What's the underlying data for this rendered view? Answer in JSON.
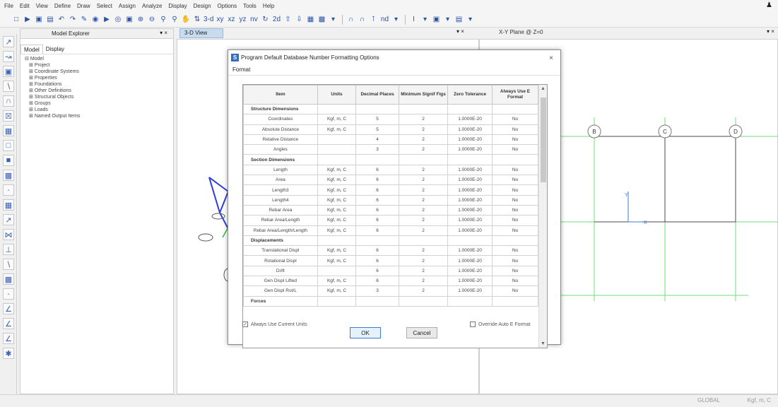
{
  "menubar": {
    "items": [
      "File",
      "Edit",
      "View",
      "Define",
      "Draw",
      "Select",
      "Assign",
      "Analyze",
      "Display",
      "Design",
      "Options",
      "Tools",
      "Help"
    ]
  },
  "toolbar": {
    "view_xy": "xy",
    "view_xz": "xz",
    "view_yz": "yz",
    "view_nv": "nv",
    "view_3d": "3-d",
    "view_2d": "2d",
    "extra": "nd"
  },
  "explorer": {
    "title": "Model Explorer",
    "close": "▾ ×",
    "tabs": [
      "Model",
      "Display"
    ],
    "tree": [
      "Model",
      "Project",
      "Coordinate Systems",
      "Properties",
      "Foundations",
      "Other Definitions",
      "Structural Objects",
      "Groups",
      "Loads",
      "Named Output Items"
    ]
  },
  "views": {
    "view3d_title": "3-D View",
    "view3d_close": "▾ ×",
    "xy_title": "X-Y Plane @ Z=0",
    "xy_close": "▾ ×",
    "grid_labels": [
      "B",
      "C",
      "D"
    ],
    "axis_y": "Y",
    "axis_x": "X"
  },
  "status": {
    "units": "GLOBAL",
    "units2": "Kgf, m, C"
  },
  "dialog": {
    "title": "Program Default Database Number Formatting Options",
    "close": "×",
    "menu": "Format",
    "columns": [
      "Item",
      "Units",
      "Decimal Places",
      "Minimum Signif Figs",
      "Zero Tolerance",
      "Always Use E Format"
    ],
    "rows": [
      {
        "section": "Structure Dimensions"
      },
      {
        "item": "Coordinates",
        "units": "Kgf, m, C",
        "dec": "5",
        "sig": "2",
        "zero": "1.0000E-20",
        "efmt": "No"
      },
      {
        "item": "Absolute Distance",
        "units": "Kgf, m, C",
        "dec": "5",
        "sig": "2",
        "zero": "1.0000E-20",
        "efmt": "No"
      },
      {
        "item": "Relative Distance",
        "units": "",
        "dec": "4",
        "sig": "2",
        "zero": "1.0000E-20",
        "efmt": "No"
      },
      {
        "item": "Angles",
        "units": "",
        "dec": "3",
        "sig": "2",
        "zero": "1.0000E-20",
        "efmt": "No"
      },
      {
        "section": "Section Dimensions"
      },
      {
        "item": "Length",
        "units": "Kgf, m, C",
        "dec": "6",
        "sig": "2",
        "zero": "1.0000E-20",
        "efmt": "No"
      },
      {
        "item": "Area",
        "units": "Kgf, m, C",
        "dec": "6",
        "sig": "2",
        "zero": "1.0000E-20",
        "efmt": "No"
      },
      {
        "item": "Length3",
        "units": "Kgf, m, C",
        "dec": "6",
        "sig": "2",
        "zero": "1.0000E-20",
        "efmt": "No"
      },
      {
        "item": "Length4",
        "units": "Kgf, m, C",
        "dec": "6",
        "sig": "2",
        "zero": "1.0000E-20",
        "efmt": "No"
      },
      {
        "item": "Rebar Area",
        "units": "Kgf, m, C",
        "dec": "6",
        "sig": "2",
        "zero": "1.0000E-20",
        "efmt": "No"
      },
      {
        "item": "Rebar Area/Length",
        "units": "Kgf, m, C",
        "dec": "6",
        "sig": "2",
        "zero": "1.0000E-20",
        "efmt": "No"
      },
      {
        "item": "Rebar Area/Length/Length",
        "units": "Kgf, m, C",
        "dec": "6",
        "sig": "2",
        "zero": "1.0000E-20",
        "efmt": "No"
      },
      {
        "section": "Displacements"
      },
      {
        "item": "Translational Displ",
        "units": "Kgf, m, C",
        "dec": "6",
        "sig": "2",
        "zero": "1.0000E-20",
        "efmt": "No"
      },
      {
        "item": "Rotational Displ",
        "units": "Kgf, m, C",
        "dec": "6",
        "sig": "2",
        "zero": "1.0000E-20",
        "efmt": "No"
      },
      {
        "item": "Drift",
        "units": "",
        "dec": "6",
        "sig": "2",
        "zero": "1.0000E-20",
        "efmt": "No"
      },
      {
        "item": "Gen Displ Lifted",
        "units": "Kgf, m, C",
        "dec": "6",
        "sig": "2",
        "zero": "1.0000E-20",
        "efmt": "No"
      },
      {
        "item": "Gen Displ Rot/L",
        "units": "Kgf, m, C",
        "dec": "3",
        "sig": "2",
        "zero": "1.0000E-20",
        "efmt": "No"
      },
      {
        "section": "Forces"
      }
    ],
    "always_current_units": "Always Use Current Units",
    "override_e_format": "Override Auto E Format",
    "ok": "OK",
    "cancel": "Cancel"
  }
}
